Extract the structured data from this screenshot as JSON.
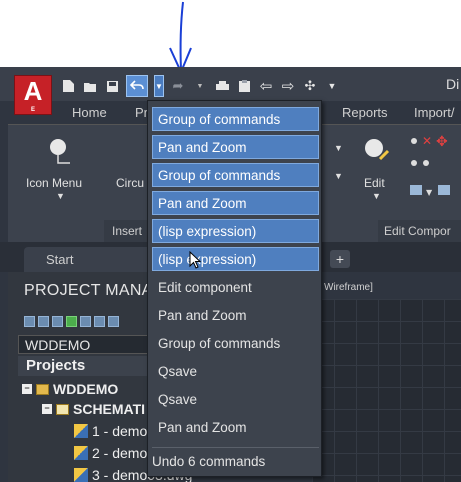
{
  "window": {
    "title_partial": "Di",
    "app_logo_letter": "A",
    "app_logo_sub": "E"
  },
  "quick_access": {
    "icons": [
      "new-icon",
      "open-icon",
      "save-icon",
      "undo-icon",
      "dropdown-arrow-icon",
      "redo-icon",
      "print-icon",
      "clipboard-icon",
      "arrow-left-icon",
      "arrow-right-icon",
      "share-icon"
    ]
  },
  "ribbon_tabs": [
    "Home",
    "Pr",
    "Reports",
    "Import/"
  ],
  "ribbon": {
    "icon_menu_label": "Icon Menu",
    "circuit_label": "Circu",
    "insert_panel": "Insert",
    "edit_label": "Edit",
    "edit_panel": "Edit Compor"
  },
  "file_tabs": {
    "start": "Start",
    "add": "+"
  },
  "project_manager": {
    "title": "PROJECT MANA",
    "current_project": "WDDEMO",
    "projects_header": "Projects",
    "tree": [
      {
        "label": "WDDEMO",
        "indent": 0,
        "kind": "project"
      },
      {
        "label": "SCHEMATI",
        "indent": 1,
        "kind": "folder"
      },
      {
        "label": "1 - demo",
        "indent": 2,
        "kind": "drawing"
      },
      {
        "label": "2 - demo",
        "indent": 2,
        "kind": "drawing"
      },
      {
        "label": "3 - demo03.dwg",
        "indent": 2,
        "kind": "drawing"
      }
    ]
  },
  "viewport": {
    "label": "D Wireframe]"
  },
  "undo_dropdown": {
    "items": [
      {
        "label": "Group of commands",
        "selected": true
      },
      {
        "label": "Pan and Zoom",
        "selected": true
      },
      {
        "label": "Group of commands",
        "selected": true
      },
      {
        "label": "Pan and Zoom",
        "selected": true
      },
      {
        "label": "(lisp expression)",
        "selected": true
      },
      {
        "label": "(lisp expression)",
        "selected": true
      },
      {
        "label": "Edit component",
        "selected": false
      },
      {
        "label": "Pan and Zoom",
        "selected": false
      },
      {
        "label": "Group of commands",
        "selected": false
      },
      {
        "label": "Qsave",
        "selected": false
      },
      {
        "label": "Qsave",
        "selected": false
      },
      {
        "label": "Pan and Zoom",
        "selected": false
      }
    ],
    "footer": "Undo 6 commands"
  },
  "colors": {
    "accent_blue": "#4f7fbf",
    "annotation_blue": "#1a3fd6",
    "logo_red": "#c62127"
  }
}
